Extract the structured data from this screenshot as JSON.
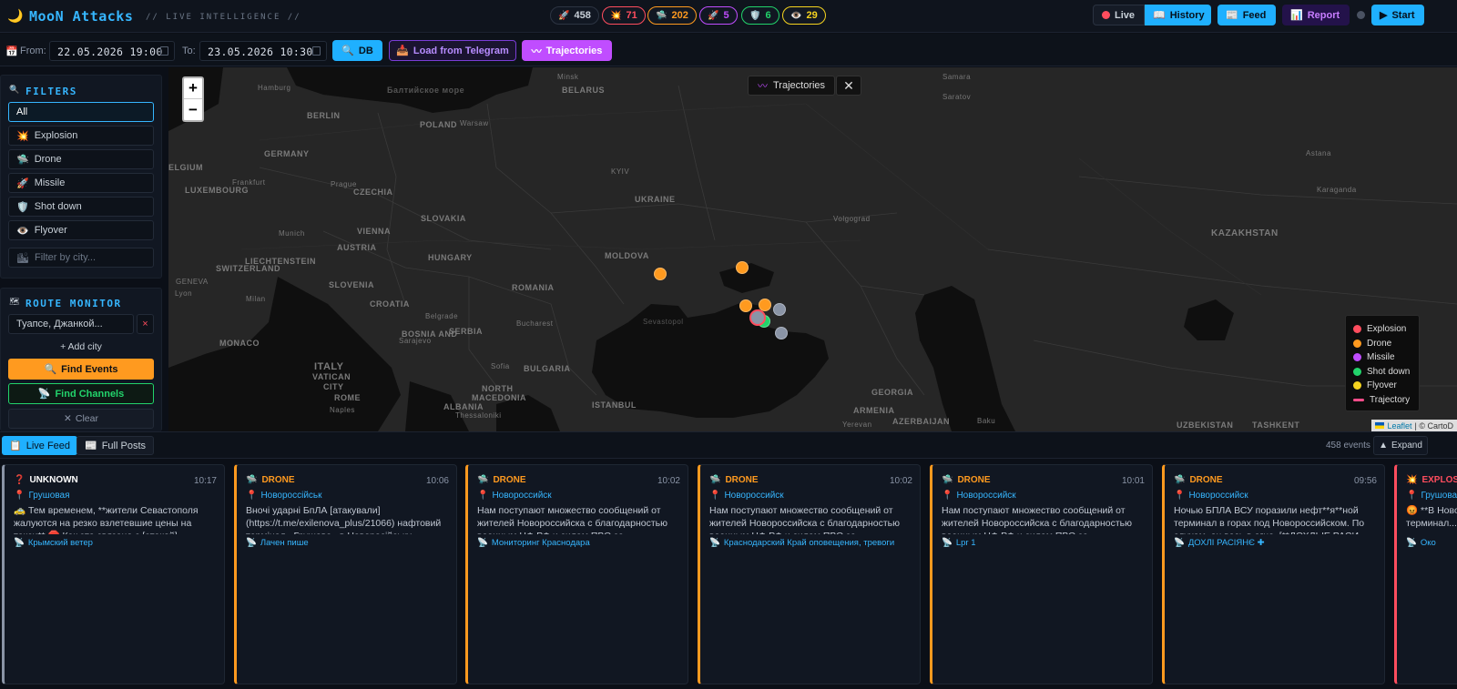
{
  "header": {
    "logo_icon": "🌙",
    "title": "MooN Attacks",
    "subtitle": "// LIVE INTELLIGENCE //",
    "counters": [
      {
        "icon": "🚀",
        "value": "458",
        "color": "#8a94a6",
        "name": "total"
      },
      {
        "icon": "💥",
        "value": "71",
        "color": "#ff4d5e",
        "name": "explosion"
      },
      {
        "icon": "🛸",
        "value": "202",
        "color": "#ff9a1f",
        "name": "drone"
      },
      {
        "icon": "🚀",
        "value": "5",
        "color": "#c04dff",
        "name": "missile"
      },
      {
        "icon": "🛡️",
        "value": "6",
        "color": "#22d36b",
        "name": "shotdown"
      },
      {
        "icon": "👁️",
        "value": "29",
        "color": "#f5d31f",
        "name": "flyover"
      }
    ],
    "live_label": "Live",
    "history_label": "History",
    "feed_label": "Feed",
    "report_label": "Report",
    "start_label": "Start"
  },
  "datebar": {
    "from_label": "From:",
    "from_value": "22.05.2026 19:00",
    "to_label": "To:",
    "to_value": "23.05.2026 10:30",
    "db_label": "DB",
    "telegram_label": "Load from Telegram",
    "trajectories_label": "Trajectories"
  },
  "filters": {
    "title": "FILTERS",
    "items": [
      {
        "icon": "",
        "label": "All"
      },
      {
        "icon": "💥",
        "label": "Explosion"
      },
      {
        "icon": "🛸",
        "label": "Drone"
      },
      {
        "icon": "🚀",
        "label": "Missile"
      },
      {
        "icon": "🛡️",
        "label": "Shot down"
      },
      {
        "icon": "👁️",
        "label": "Flyover"
      }
    ],
    "city_placeholder": "Filter by city..."
  },
  "route": {
    "title": "ROUTE MONITOR",
    "input_value": "Туапсе, Джанкой...",
    "add_label": "+ Add city",
    "find_events_label": "Find Events",
    "find_channels_label": "Find Channels",
    "clear_label": "Clear"
  },
  "map": {
    "trajectories_chip": "Trajectories",
    "labels": [
      "Hamburg",
      "Балтийское море",
      "Minsk",
      "BELARUS",
      "BERLIN",
      "Warsaw",
      "POLAND",
      "GERMANY",
      "Frankfurt",
      "Prague",
      "CZECHIA",
      "Munich",
      "VIENNA",
      "AUSTRIA",
      "LUXEMBOURG",
      "LIECHTENSTEIN",
      "SWITZERLAND",
      "GENEVA",
      "Lyon",
      "Milan",
      "SLOVAKIA",
      "HUNGARY",
      "SLOVENIA",
      "CROATIA",
      "Belgrade",
      "SERBIA",
      "ROMANIA",
      "Bucharest",
      "MOLDOVA",
      "UKRAINE",
      "KYIV",
      "Sevastopol",
      "Volgograd",
      "Saratov",
      "Samara",
      "Astana",
      "Karaganda",
      "KAZAKHSTAN",
      "ITALY",
      "VATICAN",
      "CITY",
      "ROME",
      "BULGARIA",
      "Sofia",
      "NORTH",
      "MACEDONIA",
      "ALBANIA",
      "ISTANBUL",
      "Thessaloniki",
      "Naples",
      "BOSNIA AND",
      "Sarajevo",
      "GEORGIA",
      "ARMENIA",
      "AZERBAIJAN",
      "Baku",
      "Yerevan",
      "UZBEKISTAN",
      "TASHKENT",
      "MONACO",
      "ELGIUM"
    ],
    "legend": [
      {
        "label": "Explosion",
        "color": "#ff4d5e"
      },
      {
        "label": "Drone",
        "color": "#ff9a1f"
      },
      {
        "label": "Missile",
        "color": "#c04dff"
      },
      {
        "label": "Shot down",
        "color": "#22d36b"
      },
      {
        "label": "Flyover",
        "color": "#f5d31f"
      },
      {
        "label": "Trajectory",
        "color": "#ff4d8a"
      }
    ],
    "attribution_leaflet": "Leaflet",
    "attribution_carto": "| © CartoD"
  },
  "feed": {
    "live_tab": "Live Feed",
    "posts_tab": "Full Posts",
    "count": "458 events",
    "expand_label": "Expand",
    "cards": [
      {
        "type": "UNKNOWN",
        "icon": "❓",
        "color": "#c9d1d9",
        "border": "#8a94a6",
        "time": "10:17",
        "location": "Грушовая",
        "text": "🚕 Тем временем, **жители Севастополя жалуются на резко взлетевшие цены на такси** 🛑 Как это связано с [атакой]...",
        "channel": "Крымский ветер"
      },
      {
        "type": "DRONE",
        "icon": "🛸",
        "color": "#ff9a1f",
        "border": "#ff9a1f",
        "time": "10:06",
        "location": "Новороссійськ",
        "text": "Вночі ударні БпЛА [атакували] (https://t.me/exilenova_plus/21066) нафтовий термінал «Грушова» в Новоросійську",
        "channel": "Лачен пише"
      },
      {
        "type": "DRONE",
        "icon": "🛸",
        "color": "#ff9a1f",
        "border": "#ff9a1f",
        "time": "10:02",
        "location": "Новороссийск",
        "text": "Нам поступают множество сообщений от жителей Новороссийска с благодарностью военным ЦФ РФ и силам ПВО за...",
        "channel": "Мониторинг Краснодара"
      },
      {
        "type": "DRONE",
        "icon": "🛸",
        "color": "#ff9a1f",
        "border": "#ff9a1f",
        "time": "10:02",
        "location": "Новороссийск",
        "text": "Нам поступают множество сообщений от жителей Новороссийска с благодарностью военным ЦФ РФ и силам ПВО за...",
        "channel": "Краснодарский Край оповещения, тревоги"
      },
      {
        "type": "DRONE",
        "icon": "🛸",
        "color": "#ff9a1f",
        "border": "#ff9a1f",
        "time": "10:01",
        "location": "Новороссийск",
        "text": "Нам поступают множество сообщений от жителей Новороссийска с благодарностью военным ЦФ РФ и силам ПВО за...",
        "channel": "Lpr 1"
      },
      {
        "type": "DRONE",
        "icon": "🛸",
        "color": "#ff9a1f",
        "border": "#ff9a1f",
        "time": "09:56",
        "location": "Новороссийск",
        "text": "Ночью БПЛА ВСУ поразили нефт**я**ной терминал в горах под Новороссийском. По слухам, он весь в огне. [**ДОХЛЫЕ РАСИ...",
        "channel": "ДОХЛІ РАСІЯНЄ ✚"
      },
      {
        "type": "EXPLOSION",
        "icon": "💥",
        "color": "#ff4d5e",
        "border": "#ff4d5e",
        "time": "09:50",
        "location": "Грушовая",
        "text": "😡 **В Новороссийске... «Грушовая» терминал...",
        "channel": "Око"
      }
    ]
  }
}
